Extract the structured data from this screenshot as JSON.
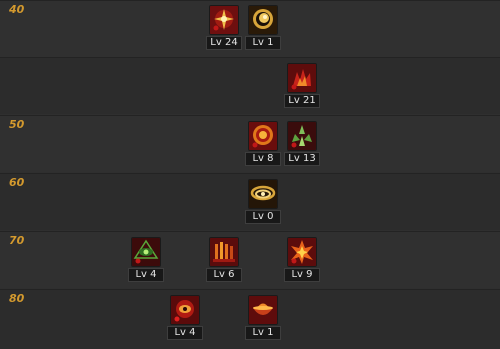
{
  "rows": [
    {
      "label": "40"
    },
    {
      "label": ""
    },
    {
      "label": "50"
    },
    {
      "label": "60"
    },
    {
      "label": "70"
    },
    {
      "label": "80"
    }
  ],
  "skills": [
    {
      "icon": "red-crystal-burst-icon",
      "level": "Lv 24"
    },
    {
      "icon": "gold-orb-icon",
      "level": "Lv 1"
    },
    {
      "icon": "red-fire-cluster-icon",
      "level": "Lv 21"
    },
    {
      "icon": "red-sun-ring-icon",
      "level": "Lv 8"
    },
    {
      "icon": "green-shards-icon",
      "level": "Lv 13"
    },
    {
      "icon": "gold-swirl-icon",
      "level": "Lv 0"
    },
    {
      "icon": "green-eye-icon",
      "level": "Lv 4"
    },
    {
      "icon": "red-pillars-icon",
      "level": "Lv 6"
    },
    {
      "icon": "red-explosion-icon",
      "level": "Lv 9"
    },
    {
      "icon": "red-eye-orb-icon",
      "level": "Lv 4"
    },
    {
      "icon": "red-flame-bowl-icon",
      "level": "Lv 1"
    }
  ],
  "colors": {
    "row_label": "#d49a2e",
    "icon_red": "#8a1414",
    "icon_gold": "#d8a53a",
    "icon_green": "#3f7a2e"
  }
}
